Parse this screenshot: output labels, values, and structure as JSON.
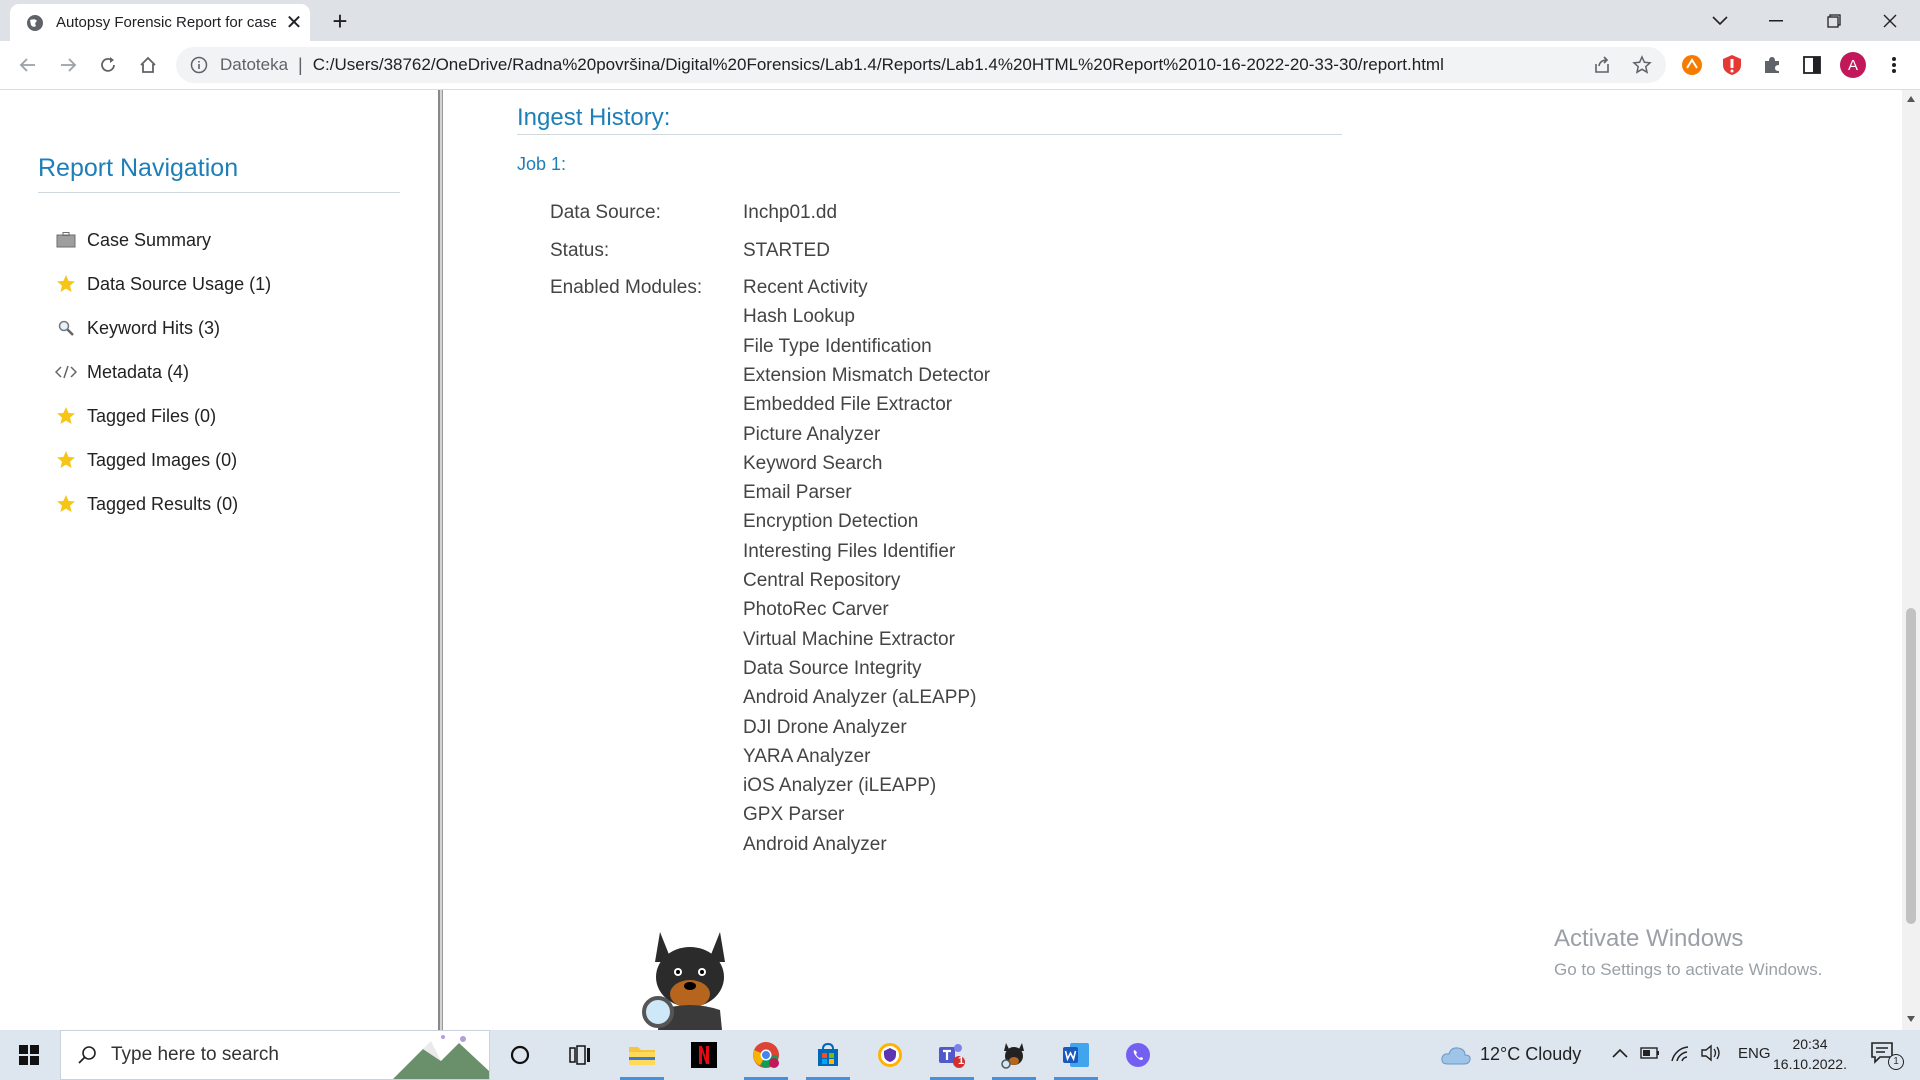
{
  "browser": {
    "tab_title": "Autopsy Forensic Report for case",
    "url_scheme_label": "Datoteka",
    "url": "C:/Users/38762/OneDrive/Radna%20površina/Digital%20Forensics/Lab1.4/Reports/Lab1.4%20HTML%20Report%2010-16-2022-20-33-30/report.html",
    "profile_initial": "A"
  },
  "nav": {
    "title": "Report Navigation",
    "items": [
      {
        "label": "Case Summary",
        "icon": "briefcase-icon"
      },
      {
        "label": "Data Source Usage (1)",
        "icon": "star-icon"
      },
      {
        "label": "Keyword Hits (3)",
        "icon": "magnifier-icon"
      },
      {
        "label": "Metadata (4)",
        "icon": "code-icon"
      },
      {
        "label": "Tagged Files (0)",
        "icon": "star-icon"
      },
      {
        "label": "Tagged Images (0)",
        "icon": "star-icon"
      },
      {
        "label": "Tagged Results (0)",
        "icon": "star-icon"
      }
    ]
  },
  "content": {
    "section_title": "Ingest History:",
    "job_title": "Job 1:",
    "data_source_label": "Data Source:",
    "data_source_value": "Inchp01.dd",
    "status_label": "Status:",
    "status_value": "STARTED",
    "modules_label": "Enabled Modules:",
    "modules": [
      "Recent Activity",
      "Hash Lookup",
      "File Type Identification",
      "Extension Mismatch Detector",
      "Embedded File Extractor",
      "Picture Analyzer",
      "Keyword Search",
      "Email Parser",
      "Encryption Detection",
      "Interesting Files Identifier",
      "Central Repository",
      "PhotoRec Carver",
      "Virtual Machine Extractor",
      "Data Source Integrity",
      "Android Analyzer (aLEAPP)",
      "DJI Drone Analyzer",
      "YARA Analyzer",
      "iOS Analyzer (iLEAPP)",
      "GPX Parser",
      "Android Analyzer"
    ]
  },
  "watermark": {
    "line1": "Activate Windows",
    "line2": "Go to Settings to activate Windows."
  },
  "taskbar": {
    "search_placeholder": "Type here to search",
    "weather": "12°C  Cloudy",
    "language": "ENG",
    "time": "20:34",
    "date": "16.10.2022.",
    "notification_count": "1",
    "teams_badge": "1"
  },
  "colors": {
    "accent": "#1e7fb8",
    "tabbar": "#dee1e6",
    "taskbar": "#dde5ee"
  }
}
